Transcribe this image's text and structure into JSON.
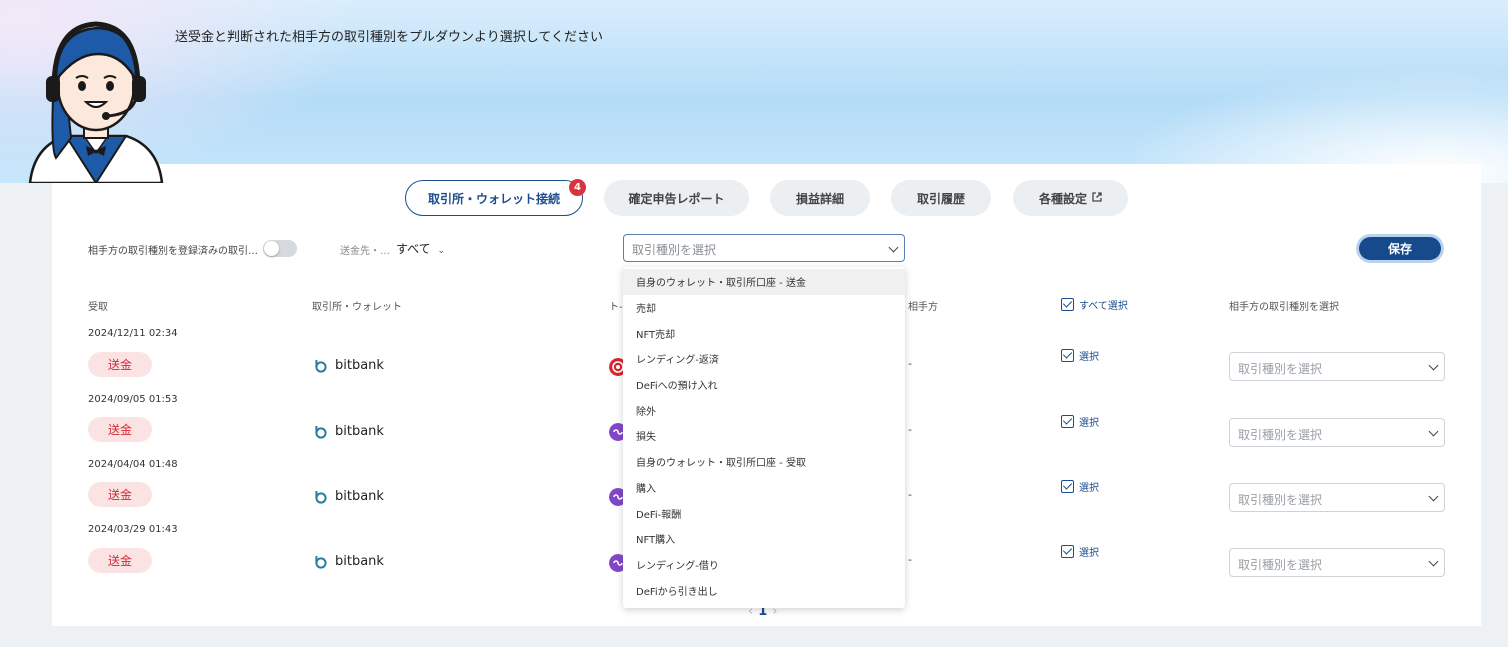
{
  "banner": {
    "message": "送受金と判断された相手方の取引種別をプルダウンより選択してください"
  },
  "nav": {
    "exchange_wallet": "取引所・ウォレット接続",
    "exchange_badge": "4",
    "tax_report": "確定申告レポート",
    "pnl_detail": "損益詳細",
    "history": "取引履歴",
    "settings": "各種設定",
    "settings_icon": "external-link-icon"
  },
  "filters": {
    "registered_toggle_label": "相手方の取引種別を登録済みの取引…",
    "destination_label": "送金先・…",
    "destination_value": "すべて",
    "type_select_placeholder": "取引種別を選択",
    "save_label": "保存"
  },
  "table": {
    "headers": {
      "received": "受取",
      "exchange": "取引所・ウォレット",
      "token": "ト-",
      "counterparty": "相手方",
      "select_all": "すべて選択",
      "counterparty_type": "相手方の取引種別を選択"
    },
    "rows": [
      {
        "date": "2024/12/11 02:34",
        "type": "送金",
        "exchange": "bitbank",
        "counterparty": "-",
        "select_label": "選択",
        "type_placeholder": "取引種別を選択",
        "token_color": "#d7262e"
      },
      {
        "date": "2024/09/05 01:53",
        "type": "送金",
        "exchange": "bitbank",
        "counterparty": "-",
        "select_label": "選択",
        "type_placeholder": "取引種別を選択",
        "token_color": "#8247c8"
      },
      {
        "date": "2024/04/04 01:48",
        "type": "送金",
        "exchange": "bitbank",
        "counterparty": "-",
        "select_label": "選択",
        "type_placeholder": "取引種別を選択",
        "token_color": "#8247c8"
      },
      {
        "date": "2024/03/29 01:43",
        "type": "送金",
        "exchange": "bitbank",
        "counterparty": "-",
        "select_label": "選択",
        "type_placeholder": "取引種別を選択",
        "token_color": "#8247c8"
      }
    ]
  },
  "dropdown": {
    "options": [
      "自身のウォレット・取引所口座 - 送金",
      "売却",
      "NFT売却",
      "レンディング-返済",
      "DeFiへの預け入れ",
      "除外",
      "損失",
      "自身のウォレット・取引所口座 - 受取",
      "購入",
      "DeFi-報酬",
      "NFT購入",
      "レンディング-借り",
      "DeFiから引き出し"
    ]
  },
  "pagination": {
    "current": "1"
  },
  "colors": {
    "primary": "#174a8b",
    "danger": "#d02b35",
    "pill_bg": "#fbe3e4"
  }
}
